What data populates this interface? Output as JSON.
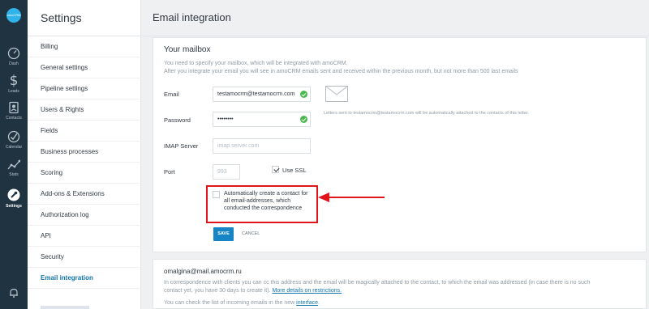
{
  "app": {
    "logo_text": "amoCRM"
  },
  "rail": {
    "items": [
      {
        "label": "Dash",
        "icon": "dashboard-icon"
      },
      {
        "label": "Leads",
        "icon": "dollar-icon"
      },
      {
        "label": "Contacts",
        "icon": "contacts-icon"
      },
      {
        "label": "Calendar",
        "icon": "calendar-check-icon"
      },
      {
        "label": "Stats",
        "icon": "stats-icon"
      },
      {
        "label": "Settings",
        "icon": "settings-icon",
        "active": true
      }
    ],
    "bell_icon": "bell-icon"
  },
  "settings": {
    "title": "Settings",
    "items": [
      {
        "label": "Billing"
      },
      {
        "label": "General settings"
      },
      {
        "label": "Pipeline settings"
      },
      {
        "label": "Users & Rights"
      },
      {
        "label": "Fields"
      },
      {
        "label": "Business processes"
      },
      {
        "label": "Scoring"
      },
      {
        "label": "Add-ons & Extensions"
      },
      {
        "label": "Authorization log"
      },
      {
        "label": "API"
      },
      {
        "label": "Security"
      },
      {
        "label": "Email integration",
        "active": true
      }
    ]
  },
  "main": {
    "title": "Email integration",
    "mailbox": {
      "heading": "Your mailbox",
      "desc_line1": "You need to specify your mailbox, which will be integrated with amoCRM.",
      "desc_line2": "After you integrate your email you will see in amoCRM emails sent and received within the previous month, but not more than 500 last emails",
      "email_label": "Email",
      "email_value": "testamocrm@testamocrm.com",
      "password_label": "Password",
      "password_value": "••••••••",
      "imap_label": "IMAP Server",
      "imap_placeholder": "imap.server.com",
      "port_label": "Port",
      "port_placeholder": "993",
      "use_ssl_label": "Use SSL",
      "use_ssl_checked": true,
      "note": "Letters sent to testamocrm@testamocrm.com will be automatically attached to the contacts of this letter.",
      "auto_contact_label": "Automatically create a contact for all email-addresses, which conducted the correspondence",
      "auto_contact_checked": false,
      "save_label": "SAVE",
      "cancel_label": "CANCEL"
    },
    "forward": {
      "address": "omalgina@mail.amocrm.ru",
      "line1": "In correspondence with clients you can cc this address and the email will be magically attached to the contact, to which the email was addressed (in case there is no such",
      "line2_text": "contact yet, you have 30 days to create it).",
      "line2_link": "More details on restrictions.",
      "line3_text": "You can check the list of incoming emails in the new",
      "line3_link": "interface",
      "line3_end": "."
    }
  },
  "colors": {
    "rail_bg": "#1f3340",
    "accent": "#1785c5",
    "highlight": "#e0151b",
    "ok": "#4ab84f"
  }
}
